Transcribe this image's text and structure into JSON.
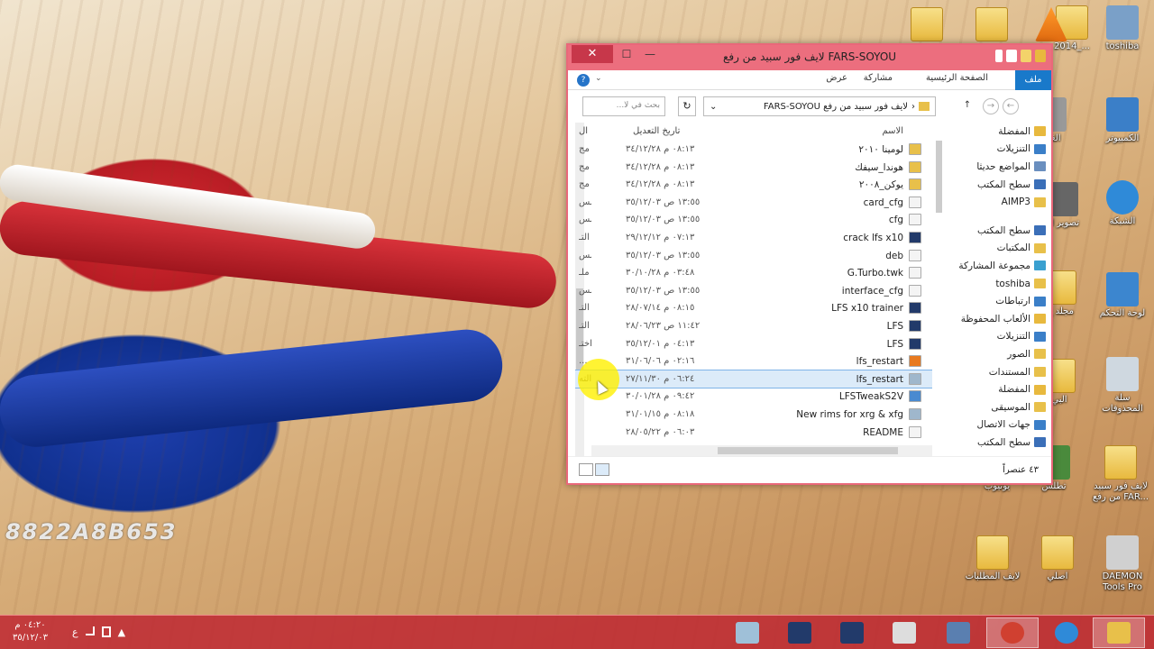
{
  "desktop": {
    "watermark": "8822A8B653",
    "icons": [
      {
        "label": "toshiba",
        "color": "#7aa0c8"
      },
      {
        "label": "2014_...",
        "color": "#e8c04a"
      },
      {
        "label": "الكمبيوتر",
        "color": "#3b7fc8"
      },
      {
        "label": "الشبكة",
        "color": "#2f8ad8"
      },
      {
        "label": "لوحة التحكم",
        "color": "#3c86cf"
      },
      {
        "label": "سلة المحذوفات",
        "color": "#cfd8e0"
      },
      {
        "label": "لايف فور سبيد من رفع FAR...",
        "color": "#e8c04a"
      },
      {
        "label": "DAEMON Tools Pro",
        "color": "#d0d0d0"
      },
      {
        "label": "اصلي",
        "color": "#e8c04a"
      },
      {
        "label": "لايف المطلبات",
        "color": "#e8c04a"
      },
      {
        "label": "تطلش",
        "color": "#4a8a3c"
      },
      {
        "label": "يوتيوب",
        "color": "#e8c04a"
      },
      {
        "label": "الغات",
        "color": "#999"
      },
      {
        "label": "تصوير ال",
        "color": "#666"
      },
      {
        "label": "مجلد ج",
        "color": "#e8c04a"
      },
      {
        "label": "البي",
        "color": "#e8c04a"
      }
    ]
  },
  "window": {
    "title": "لايف فور سبيد من رفع FARS-SOYOU",
    "close": "✕",
    "maximize": "☐",
    "minimize": "—",
    "ribbon": {
      "file": "ملف",
      "home": "الصفحة الرئيسية",
      "share": "مشاركة",
      "view": "عرض",
      "help": "?",
      "chevron": "⌄"
    },
    "address": {
      "path": "لايف فور سبيد من رفع FARS-SOYOU",
      "sep": "‹",
      "refresh": "↻",
      "dropdown": "⌄"
    },
    "nav_buttons": {
      "back": "←",
      "forward": "→",
      "up": "↑"
    },
    "search_placeholder": "بحث في لا...",
    "columns": {
      "name": "الاسم",
      "date": "تاريخ التعديل",
      "type": "ال"
    },
    "navpane": [
      {
        "label": "المفضلة",
        "color": "#e8b93e"
      },
      {
        "label": "التنزيلات",
        "color": "#3b7fc8"
      },
      {
        "label": "المواضع حديثا",
        "color": "#6a8fbf"
      },
      {
        "label": "سطح المكتب",
        "color": "#3b6fb8"
      },
      {
        "label": "AIMP3",
        "color": "#e8c04a"
      },
      {
        "label": "",
        "gap": true
      },
      {
        "label": "سطح المكتب",
        "color": "#3b6fb8"
      },
      {
        "label": "المكتبات",
        "color": "#e8c04a"
      },
      {
        "label": "مجموعة المشاركة",
        "color": "#3aa0d0"
      },
      {
        "label": "toshiba",
        "color": "#e8c04a"
      },
      {
        "label": "ارتباطات",
        "color": "#3b7fc8"
      },
      {
        "label": "الألعاب المحفوظة",
        "color": "#e8b93e"
      },
      {
        "label": "التنزيلات",
        "color": "#3b7fc8"
      },
      {
        "label": "الصور",
        "color": "#e8c04a"
      },
      {
        "label": "المستندات",
        "color": "#e8c04a"
      },
      {
        "label": "المفضلة",
        "color": "#e8b93e"
      },
      {
        "label": "الموسيقى",
        "color": "#e8c04a"
      },
      {
        "label": "جهات الاتصال",
        "color": "#3b7fc8"
      },
      {
        "label": "سطح المكتب",
        "color": "#3b6fb8"
      }
    ],
    "files": [
      {
        "name": "لومينا ٢٠١٠",
        "date": "٠٨:١٣ م ٣٤/١٢/٢٨",
        "type": "مج",
        "icon": "#e8c04a"
      },
      {
        "name": "هوندا_سيفك",
        "date": "٠٨:١٣ م ٣٤/١٢/٢٨",
        "type": "مج",
        "icon": "#e8c04a"
      },
      {
        "name": "يوكن_٢٠٠٨",
        "date": "٠٨:١٣ م ٣٤/١٢/٢٨",
        "type": "مج",
        "icon": "#e8c04a"
      },
      {
        "name": "card_cfg",
        "date": "١٣:٥٥ ص ٣٥/١٢/٠٣",
        "type": "مس",
        "icon": "#f4f4f4"
      },
      {
        "name": "cfg",
        "date": "١٣:٥٥ ص ٣٥/١٢/٠٣",
        "type": "مس",
        "icon": "#f4f4f4"
      },
      {
        "name": "crack lfs x10",
        "date": "٠٧:١٣ م ٢٩/١٢/١٢",
        "type": "التـ",
        "icon": "#223a6a"
      },
      {
        "name": "deb",
        "date": "١٣:٥٥ ص ٣٥/١٢/٠٣",
        "type": "مس",
        "icon": "#f4f4f4"
      },
      {
        "name": "G.Turbo.twk",
        "date": "٠٣:٤٨ م ٣٠/١٠/٢٨",
        "type": "ملـ",
        "icon": "#f4f4f4"
      },
      {
        "name": "interface_cfg",
        "date": "١٣:٥٥ ص ٣٥/١٢/٠٣",
        "type": "مس",
        "icon": "#f4f4f4"
      },
      {
        "name": "LFS x10 trainer",
        "date": "٠٨:١٥ م ٢٨/٠٧/١٤",
        "type": "التـ",
        "icon": "#223a6a"
      },
      {
        "name": "LFS",
        "date": "١١:٤٢ ص ٢٨/٠٦/٢٣",
        "type": "التـ",
        "icon": "#223a6a"
      },
      {
        "name": "LFS",
        "date": "٠٤:١٣ م ٣٥/١٢/٠١",
        "type": "اختـ",
        "icon": "#223a6a"
      },
      {
        "name": "lfs_restart",
        "date": "٠٢:١٦ م ٣١/٠٦/٠٦",
        "type": "...",
        "icon": "#e87a20"
      },
      {
        "name": "lfs_restart",
        "date": "٠٦:٢٤ م ٢٧/١١/٣٠",
        "type": "الته",
        "icon": "#9fb7cc",
        "selected": true
      },
      {
        "name": "LFSTweakS2V",
        "date": "٠٩:٤٢ م ٣٠/٠١/٢٨",
        "type": "",
        "icon": "#4a8ad0"
      },
      {
        "name": "New rims for xrg & xfg",
        "date": "٠٨:١٨ م ٣١/٠١/١٥",
        "type": "",
        "icon": "#9fb7cc"
      },
      {
        "name": "README",
        "date": "٠٦:٠٣ م ٢٨/٠٥/٢٢",
        "type": "",
        "icon": "#f4f4f4"
      }
    ],
    "status": "٤٣ عنصراً"
  },
  "taskbar": {
    "clock_time": "٠٤:٢٠ م",
    "clock_date": "٣٥/١٢/٠٣",
    "lang": "ع",
    "tray": "▲",
    "apps": [
      {
        "name": "explorer",
        "color": "#e8c04a",
        "active": true
      },
      {
        "name": "ie",
        "color": "#2f8ad8"
      },
      {
        "name": "chrome",
        "color": "#d04030",
        "active": true
      },
      {
        "name": "printer",
        "color": "#5a7fb0"
      },
      {
        "name": "computer",
        "color": "#ddd"
      },
      {
        "name": "lfs-1",
        "color": "#223a6a"
      },
      {
        "name": "lfs-2",
        "color": "#223a6a"
      },
      {
        "name": "mystery",
        "color": "#9fc0d8"
      }
    ]
  }
}
